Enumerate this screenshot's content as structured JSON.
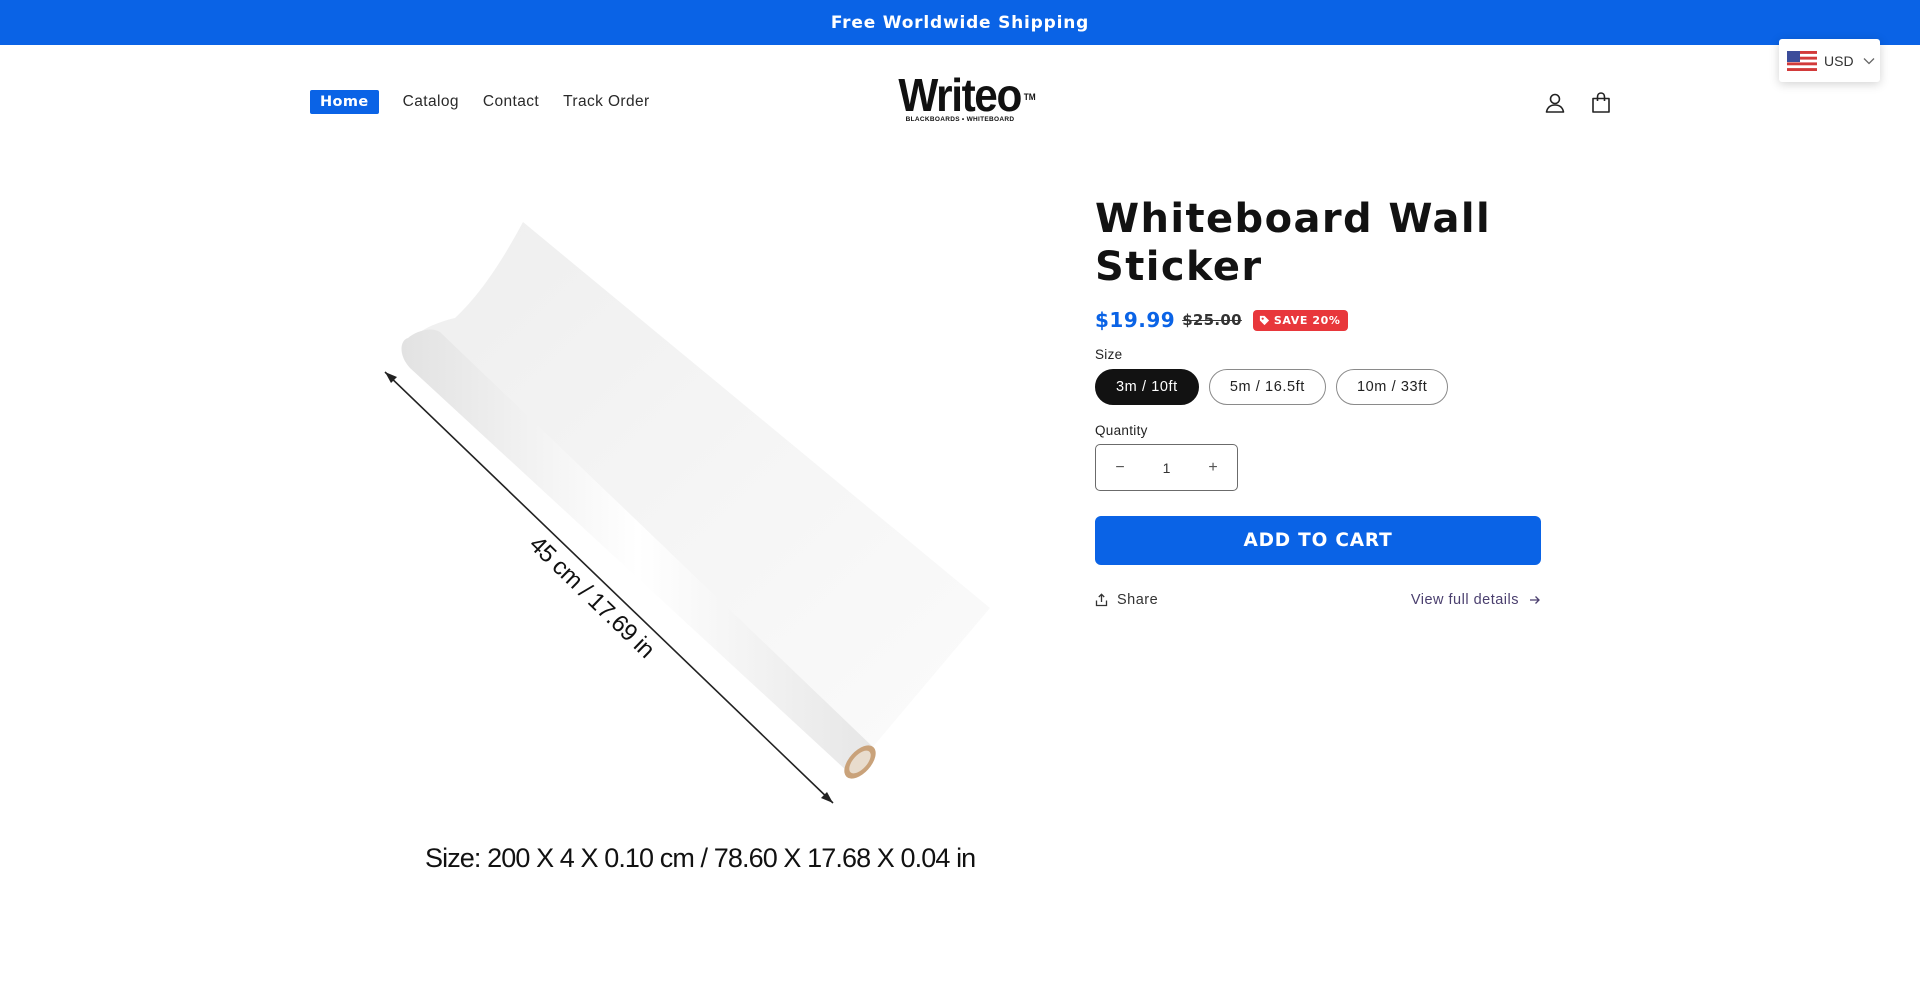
{
  "announcement": {
    "text": "Free Worldwide Shipping"
  },
  "currency": {
    "label": "USD",
    "flag_icon": "us-flag-icon"
  },
  "nav": {
    "items": [
      {
        "label": "Home",
        "active": true
      },
      {
        "label": "Catalog",
        "active": false
      },
      {
        "label": "Contact",
        "active": false
      },
      {
        "label": "Track Order",
        "active": false
      }
    ]
  },
  "logo": {
    "name": "Writeo",
    "trademark": "TM",
    "tagline": "BLACKBOARDS • WHITEBOARD"
  },
  "header_icons": [
    "account-icon",
    "cart-bag-icon"
  ],
  "product": {
    "title": "Whiteboard Wall Sticker",
    "price": "$19.99",
    "compare_price": "$25.00",
    "badge": "SAVE 20%",
    "image": {
      "dimension_label": "45 cm / 17.69 in",
      "size_caption": "Size: 200 X 4 X 0.10 cm / 78.60 X 17.68 X 0.04 in"
    },
    "size_label": "Size",
    "sizes": [
      {
        "label": "3m / 10ft",
        "selected": true
      },
      {
        "label": "5m / 16.5ft",
        "selected": false
      },
      {
        "label": "10m / 33ft",
        "selected": false
      }
    ],
    "quantity_label": "Quantity",
    "quantity": "1",
    "minus": "−",
    "plus": "+",
    "add_to_cart": "ADD TO CART",
    "share": "Share",
    "view_details": "View full details"
  },
  "colors": {
    "accent": "#0a63e6",
    "badge": "#e8373b",
    "dark": "#121212"
  }
}
